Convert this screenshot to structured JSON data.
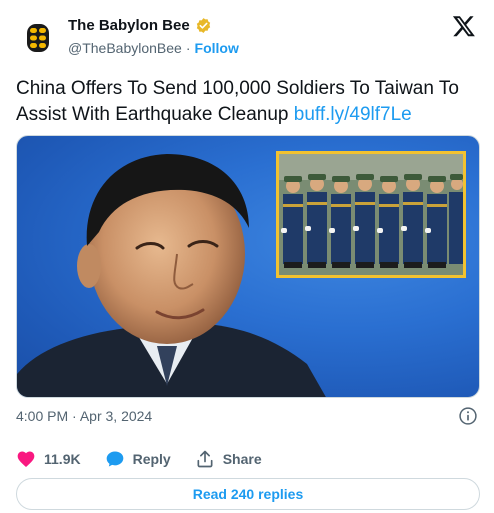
{
  "author": {
    "display_name": "The Babylon Bee",
    "handle": "@TheBabylonBee",
    "separator": "·",
    "follow_label": "Follow"
  },
  "post": {
    "text": "China Offers To Send 100,000 Soldiers To Taiwan To Assist With Earthquake Cleanup",
    "link": "buff.ly/49lf7Le",
    "time": "4:00 PM",
    "date_separator": "·",
    "date": "Apr 3, 2024"
  },
  "actions": {
    "likes_count": "11.9K",
    "reply_label": "Reply",
    "share_label": "Share"
  },
  "replies_button": "Read 240 replies",
  "colors": {
    "link_blue": "#1d9bf0",
    "like_pink": "#f91880",
    "text_primary": "#0f1419",
    "text_secondary": "#536471",
    "verified_gold": "#e8b829",
    "media_blue": "#2a6fd1",
    "inset_border": "#f2c230"
  },
  "icons": {
    "avatar": "bee-logo-icon",
    "verified": "verified-badge-icon",
    "platform": "x-logo-icon",
    "info": "info-icon",
    "like": "heart-icon",
    "reply": "reply-bubble-icon",
    "share": "share-icon"
  }
}
